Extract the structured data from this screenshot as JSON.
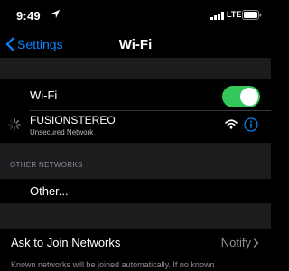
{
  "status_bar": {
    "time": "9:49",
    "network_type": "LTE",
    "icons": [
      "location-arrow-icon",
      "cellular-signal-icon",
      "battery-icon"
    ]
  },
  "nav": {
    "back_label": "Settings",
    "title": "Wi-Fi",
    "back_icon": "chevron-left-icon"
  },
  "wifi_toggle": {
    "label": "Wi-Fi",
    "on": true
  },
  "current_network": {
    "name": "FUSIONSTEREO",
    "subtitle": "Unsecured Network",
    "icons": [
      "spinner-icon",
      "wifi-signal-icon",
      "info-icon"
    ]
  },
  "other_networks": {
    "header": "OTHER NETWORKS",
    "other_label": "Other..."
  },
  "ask_to_join": {
    "label": "Ask to Join Networks",
    "value": "Notify",
    "footer": "Known networks will be joined automatically. If no known"
  },
  "colors": {
    "accent": "#0a84ff",
    "toggle_on": "#34c759",
    "background": "#000000",
    "grouped_background": "#1c1c1e",
    "secondary_text": "#8e8e93"
  }
}
